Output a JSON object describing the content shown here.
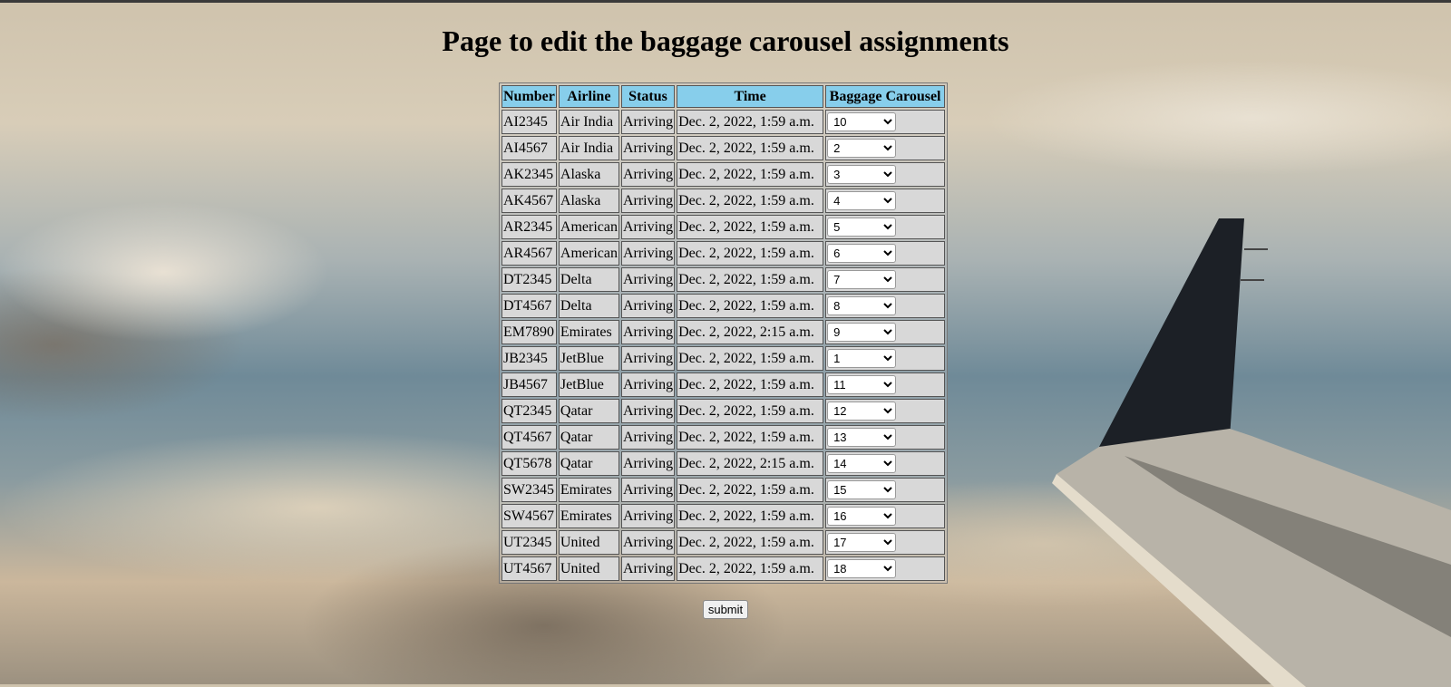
{
  "page": {
    "title": "Page to edit the baggage carousel assignments",
    "submit_label": "submit"
  },
  "table": {
    "headers": [
      "Number",
      "Airline",
      "Status",
      "Time",
      "Baggage Carousel"
    ],
    "rows": [
      {
        "number": "AI2345",
        "airline": "Air India",
        "status": "Arriving",
        "time": "Dec. 2, 2022, 1:59 a.m.",
        "carousel": "10"
      },
      {
        "number": "AI4567",
        "airline": "Air India",
        "status": "Arriving",
        "time": "Dec. 2, 2022, 1:59 a.m.",
        "carousel": "2"
      },
      {
        "number": "AK2345",
        "airline": "Alaska",
        "status": "Arriving",
        "time": "Dec. 2, 2022, 1:59 a.m.",
        "carousel": "3"
      },
      {
        "number": "AK4567",
        "airline": "Alaska",
        "status": "Arriving",
        "time": "Dec. 2, 2022, 1:59 a.m.",
        "carousel": "4"
      },
      {
        "number": "AR2345",
        "airline": "American",
        "status": "Arriving",
        "time": "Dec. 2, 2022, 1:59 a.m.",
        "carousel": "5"
      },
      {
        "number": "AR4567",
        "airline": "American",
        "status": "Arriving",
        "time": "Dec. 2, 2022, 1:59 a.m.",
        "carousel": "6"
      },
      {
        "number": "DT2345",
        "airline": "Delta",
        "status": "Arriving",
        "time": "Dec. 2, 2022, 1:59 a.m.",
        "carousel": "7"
      },
      {
        "number": "DT4567",
        "airline": "Delta",
        "status": "Arriving",
        "time": "Dec. 2, 2022, 1:59 a.m.",
        "carousel": "8"
      },
      {
        "number": "EM7890",
        "airline": "Emirates",
        "status": "Arriving",
        "time": "Dec. 2, 2022, 2:15 a.m.",
        "carousel": "9"
      },
      {
        "number": "JB2345",
        "airline": "JetBlue",
        "status": "Arriving",
        "time": "Dec. 2, 2022, 1:59 a.m.",
        "carousel": "1"
      },
      {
        "number": "JB4567",
        "airline": "JetBlue",
        "status": "Arriving",
        "time": "Dec. 2, 2022, 1:59 a.m.",
        "carousel": "11"
      },
      {
        "number": "QT2345",
        "airline": "Qatar",
        "status": "Arriving",
        "time": "Dec. 2, 2022, 1:59 a.m.",
        "carousel": "12"
      },
      {
        "number": "QT4567",
        "airline": "Qatar",
        "status": "Arriving",
        "time": "Dec. 2, 2022, 1:59 a.m.",
        "carousel": "13"
      },
      {
        "number": "QT5678",
        "airline": "Qatar",
        "status": "Arriving",
        "time": "Dec. 2, 2022, 2:15 a.m.",
        "carousel": "14"
      },
      {
        "number": "SW2345",
        "airline": "Emirates",
        "status": "Arriving",
        "time": "Dec. 2, 2022, 1:59 a.m.",
        "carousel": "15"
      },
      {
        "number": "SW4567",
        "airline": "Emirates",
        "status": "Arriving",
        "time": "Dec. 2, 2022, 1:59 a.m.",
        "carousel": "16"
      },
      {
        "number": "UT2345",
        "airline": "United",
        "status": "Arriving",
        "time": "Dec. 2, 2022, 1:59 a.m.",
        "carousel": "17"
      },
      {
        "number": "UT4567",
        "airline": "United",
        "status": "Arriving",
        "time": "Dec. 2, 2022, 1:59 a.m.",
        "carousel": "18"
      }
    ]
  },
  "colors": {
    "header_bg": "#87ceeb",
    "cell_bg": "#d8d8d8"
  }
}
